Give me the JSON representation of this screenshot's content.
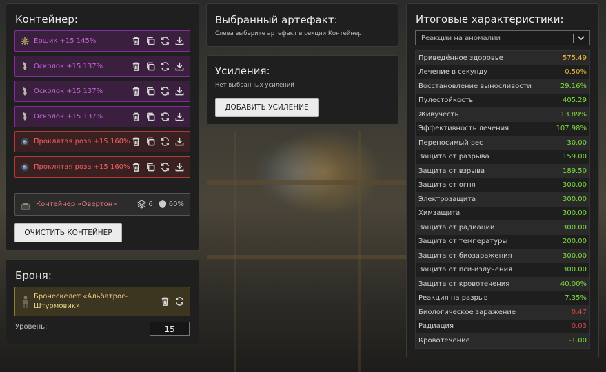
{
  "container": {
    "title": "Контейнер:",
    "artifacts": [
      {
        "name": "Ёршик +15 145%",
        "style": "purple",
        "icon": "urchin-artifact-icon"
      },
      {
        "name": "Осколок +15 137%",
        "style": "purple",
        "icon": "shard-artifact-icon"
      },
      {
        "name": "Осколок +15 137%",
        "style": "purple",
        "icon": "shard-artifact-icon"
      },
      {
        "name": "Осколок +15 137%",
        "style": "purple",
        "icon": "shard-artifact-icon"
      },
      {
        "name": "Проклятая роза +15 160%",
        "style": "red",
        "icon": "cursed-rose-artifact-icon"
      },
      {
        "name": "Проклятая роза +15 160%",
        "style": "red",
        "icon": "cursed-rose-artifact-icon"
      }
    ],
    "container_item": {
      "name": "Контейнер «Овертон»",
      "slots": "6",
      "protection": "60%"
    },
    "clear_button": "ОЧИСТИТЬ КОНТЕЙНЕР"
  },
  "armor": {
    "title": "Броня:",
    "name": "Бронескелет «Альбатрос-Штурмовик»",
    "level_label": "Уровень:",
    "level_value": "15"
  },
  "selected": {
    "title": "Выбранный артефакт:",
    "hint": "Слева выберите артефакт в секции Контейнер"
  },
  "boosts": {
    "title": "Усиления:",
    "empty_text": "Нет выбранных усилений",
    "add_button": "ДОБАВИТЬ УСИЛЕНИЕ"
  },
  "stats": {
    "title": "Итоговые характеристики:",
    "filter_selected": "Реакции на аномалии",
    "colors": {
      "yellow": "#e8b83a",
      "green": "#7ddc3c",
      "red": "#e04848"
    },
    "rows": [
      {
        "label": "Приведённое здоровье",
        "value": "575.49",
        "color": "yellow"
      },
      {
        "label": "Лечение в секунду",
        "value": "0.50%",
        "color": "yellow"
      },
      {
        "label": "Восстановление выносливости",
        "value": "29.16%",
        "color": "green"
      },
      {
        "label": "Пулестойкость",
        "value": "405.29",
        "color": "green"
      },
      {
        "label": "Живучесть",
        "value": "13.89%",
        "color": "green"
      },
      {
        "label": "Эффективность лечения",
        "value": "107.98%",
        "color": "green"
      },
      {
        "label": "Переносимый вес",
        "value": "30.00",
        "color": "green"
      },
      {
        "label": "Защита от разрыва",
        "value": "159.00",
        "color": "green"
      },
      {
        "label": "Защита от взрыва",
        "value": "189.50",
        "color": "green"
      },
      {
        "label": "Защита от огня",
        "value": "300.00",
        "color": "green"
      },
      {
        "label": "Электрозащита",
        "value": "300.00",
        "color": "green"
      },
      {
        "label": "Химзащита",
        "value": "300.00",
        "color": "green"
      },
      {
        "label": "Защита от радиации",
        "value": "300.00",
        "color": "green"
      },
      {
        "label": "Защита от температуры",
        "value": "200.00",
        "color": "green"
      },
      {
        "label": "Защита от биозаражения",
        "value": "300.00",
        "color": "green"
      },
      {
        "label": "Защита от пси-излучения",
        "value": "300.00",
        "color": "green"
      },
      {
        "label": "Защита от кровотечения",
        "value": "40.00%",
        "color": "green"
      },
      {
        "label": "Реакция на разрыв",
        "value": "7.35%",
        "color": "green"
      },
      {
        "label": "Биологическое заражение",
        "value": "0.47",
        "color": "red"
      },
      {
        "label": "Радиация",
        "value": "0.03",
        "color": "red"
      },
      {
        "label": "Кровотечение",
        "value": "-1.00",
        "color": "green"
      }
    ]
  }
}
